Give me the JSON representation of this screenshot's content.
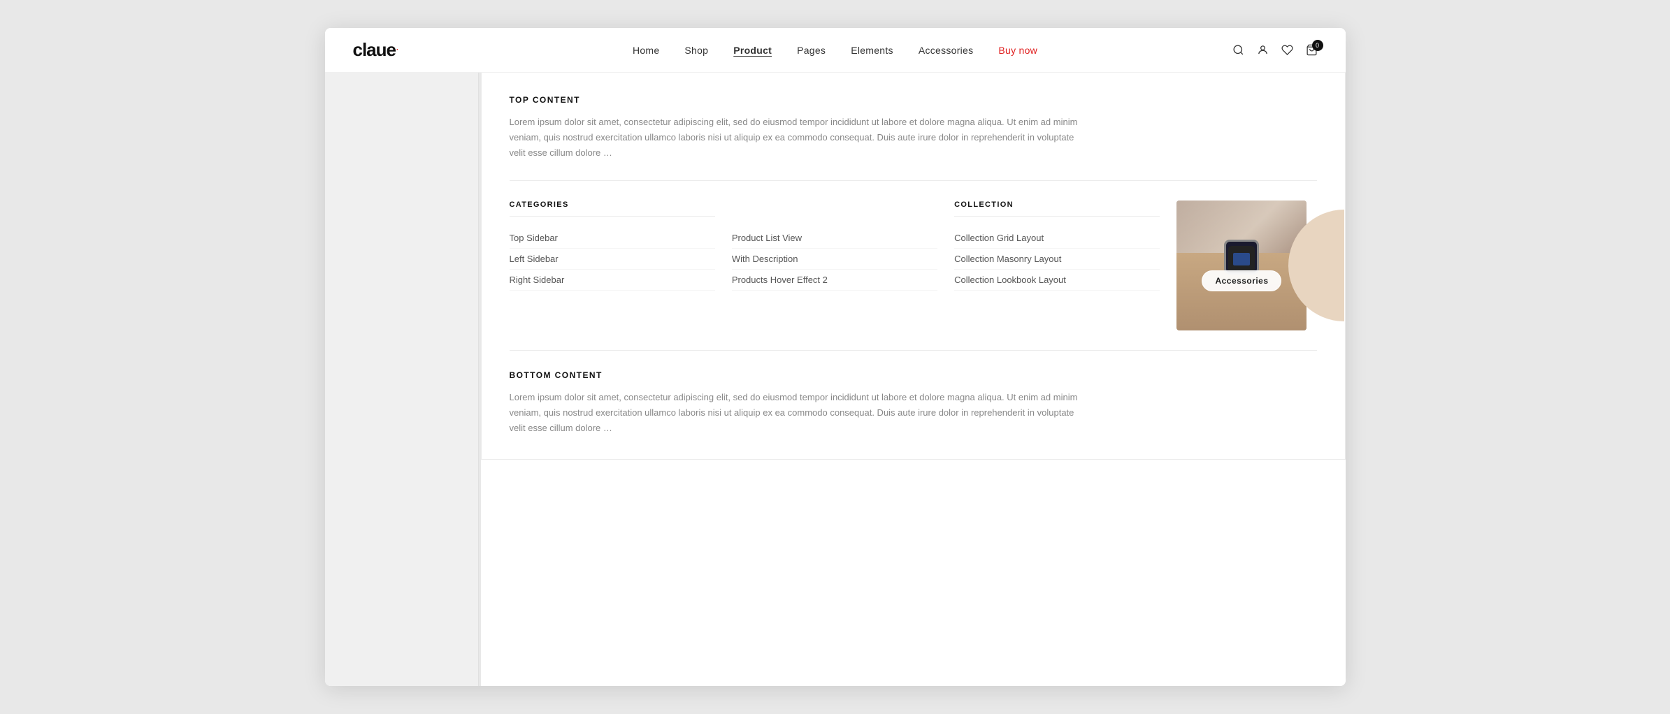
{
  "header": {
    "logo": "claue",
    "logo_dot": "·",
    "nav_items": [
      {
        "label": "Home",
        "active": false
      },
      {
        "label": "Shop",
        "active": false
      },
      {
        "label": "Product",
        "active": true
      },
      {
        "label": "Pages",
        "active": false
      },
      {
        "label": "Elements",
        "active": false
      },
      {
        "label": "Accessories",
        "active": false
      },
      {
        "label": "Buy now",
        "active": false,
        "special": "buy-now"
      }
    ],
    "cart_count": "0"
  },
  "dropdown": {
    "top_content_title": "TOP CONTENT",
    "top_content_text": "Lorem ipsum dolor sit amet, consectetur adipiscing elit, sed do eiusmod tempor incididunt ut labore et dolore magna aliqua. Ut enim ad minim veniam, quis nostrud exercitation ullamco laboris nisi ut aliquip ex ea commodo consequat. Duis aute irure dolor in reprehenderit in voluptate velit esse cillum dolore …",
    "categories_title": "CATEGORIES",
    "categories_links": [
      {
        "label": "Top Sidebar"
      },
      {
        "label": "Left Sidebar"
      },
      {
        "label": "Right Sidebar"
      }
    ],
    "col2_links": [
      {
        "label": "Product List View"
      },
      {
        "label": "With Description"
      },
      {
        "label": "Products Hover Effect 2"
      }
    ],
    "collection_title": "COLLECTION",
    "collection_links": [
      {
        "label": "Collection Grid Layout"
      },
      {
        "label": "Collection Masonry Layout"
      },
      {
        "label": "Collection Lookbook Layout"
      }
    ],
    "image_badge": "Accessories",
    "bottom_content_title": "BOTTOM CONTENT",
    "bottom_content_text": "Lorem ipsum dolor sit amet, consectetur adipiscing elit, sed do eiusmod tempor incididunt ut labore et dolore magna aliqua. Ut enim ad minim veniam, quis nostrud exercitation ullamco laboris nisi ut aliquip ex ea commodo consequat. Duis aute irure dolor in reprehenderit in voluptate velit esse cillum dolore …"
  }
}
